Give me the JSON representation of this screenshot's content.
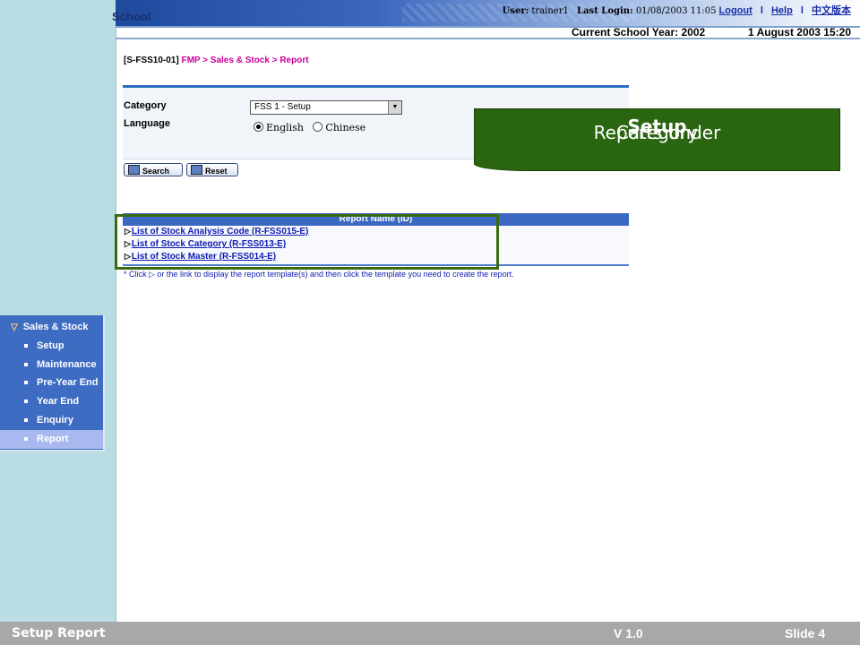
{
  "header": {
    "school_label": "School",
    "user_label": "User:",
    "user_value": "trainer1",
    "last_login_label": "Last Login:",
    "last_login_value": "01/08/2003 11:05",
    "logout": "Logout",
    "help": "Help",
    "chinese_version": "中文版本",
    "separator": "l",
    "school_year": "Current School Year: 2002",
    "current_date": "1 August 2003 15:20"
  },
  "breadcrumb": {
    "code": "[S-FSS10-01]",
    "path": "FMP > Sales & Stock > Report"
  },
  "filter": {
    "category_label": "Category",
    "category_value": "FSS 1 - Setup",
    "language_label": "Language",
    "lang_english": "English",
    "lang_chinese": "Chinese",
    "search_label": "Search",
    "reset_label": "Reset"
  },
  "report_table": {
    "header": "Report Name (ID)",
    "rows": [
      "List of Stock Analysis Code (R-FSS015-E)",
      "List of Stock Category (R-FSS013-E)",
      "List of Stock Master (R-FSS014-E)"
    ],
    "note": "* Click ▷ or the link to display the report template(s) and then click the template you need to create the report."
  },
  "callout": {
    "prefix": "Reports under ",
    "bold": "Setup",
    "suffix": " Category"
  },
  "nav": {
    "title": "Sales & Stock",
    "items": [
      "Setup",
      "Maintenance",
      "Pre-Year End",
      "Year End",
      "Enquiry",
      "Report"
    ],
    "active": "Report"
  },
  "footer": {
    "left": "Setup Report",
    "center": "V 1.0",
    "right": "Slide 4"
  },
  "colors": {
    "callout_bg": "#2a6510",
    "nav_bg": "#3d6cc2",
    "nav_active_bg": "#a9b8ef",
    "table_header_bg": "#3b69c1",
    "link_color": "#0d1bb3",
    "breadcrumb_color": "#cc0099"
  }
}
